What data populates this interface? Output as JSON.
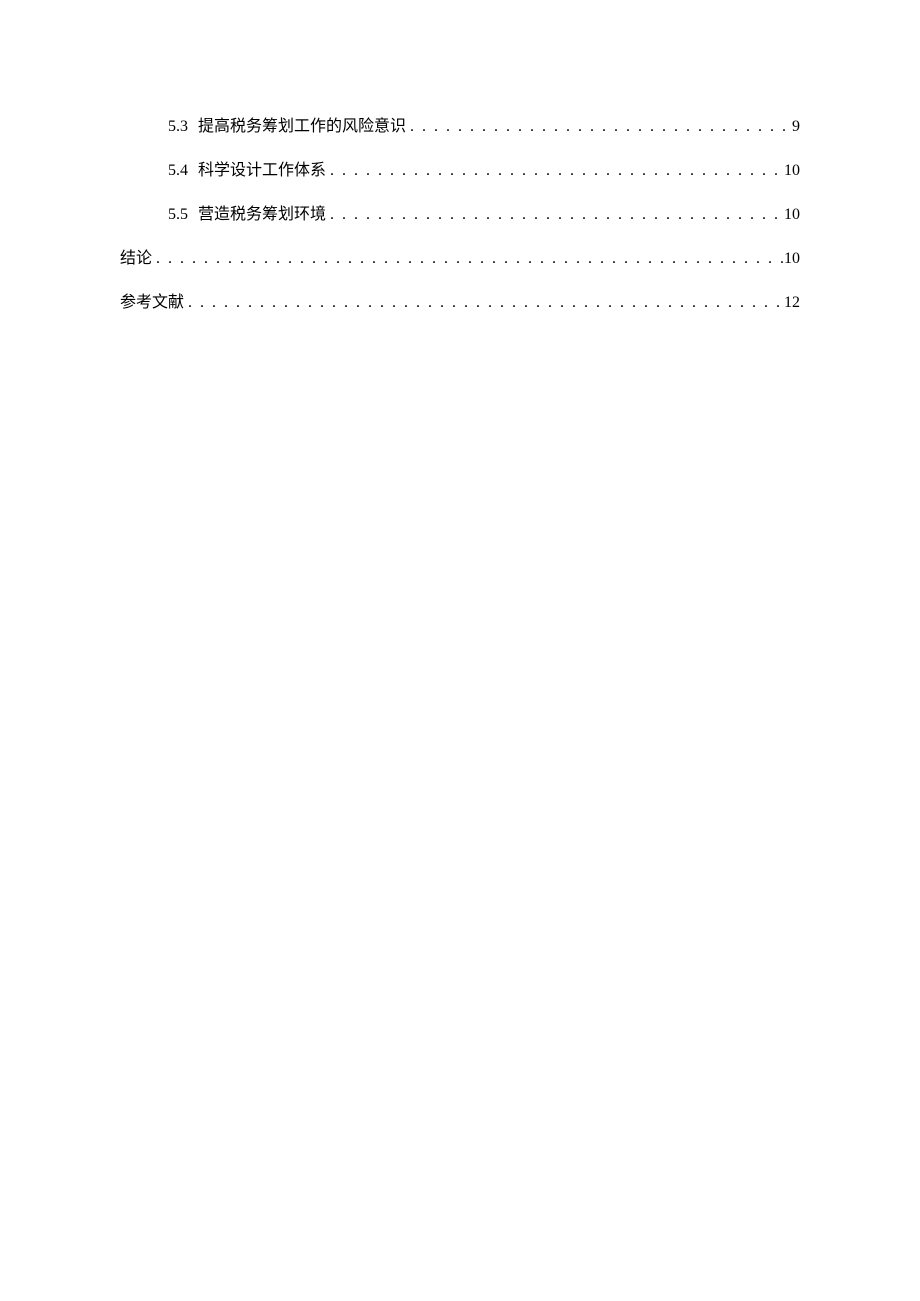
{
  "toc": {
    "entries": [
      {
        "level": 2,
        "number": "5.3",
        "title": "提高税务筹划工作的风险意识",
        "page": "9"
      },
      {
        "level": 2,
        "number": "5.4",
        "title": "科学设计工作体系",
        "page": "10"
      },
      {
        "level": 2,
        "number": "5.5",
        "title": "营造税务筹划环境",
        "page": "10"
      },
      {
        "level": 1,
        "number": "",
        "title": "结论",
        "page": "10"
      },
      {
        "level": 1,
        "number": "",
        "title": "参考文献",
        "page": "12"
      }
    ]
  }
}
